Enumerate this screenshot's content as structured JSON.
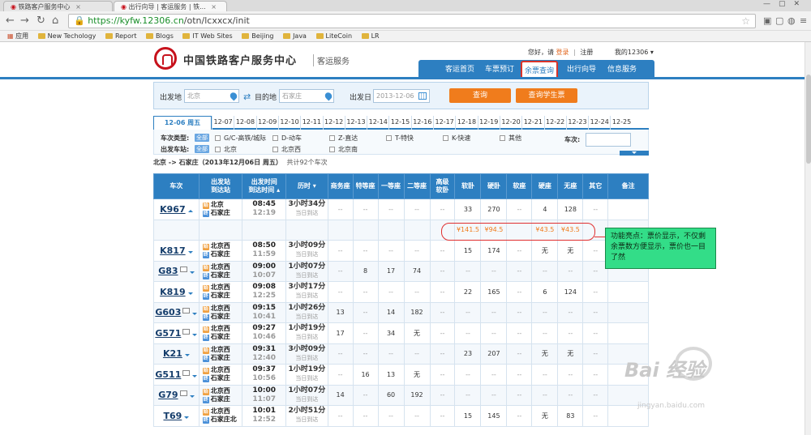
{
  "browser": {
    "tabs": [
      {
        "label": "铁路客户服务中心"
      },
      {
        "label": "出行向导 | 客运服务 | 铁..."
      }
    ],
    "url_host": "https://kyfw.12306.cn",
    "url_path": "/otn/lcxxcx/init",
    "bookmarks": [
      "应用",
      "New Techology",
      "Report",
      "Blogs",
      "IT Web Sites",
      "Beijing",
      "Java",
      "LiteCoin",
      "LR"
    ]
  },
  "site": {
    "name": "中国铁路客户服务中心",
    "sub": "客运服务",
    "greeting": "您好，请",
    "login": "登录",
    "register": "注册",
    "my": "我的12306"
  },
  "nav": {
    "items": [
      "客运首页",
      "车票预订",
      "余票查询",
      "出行向导",
      "信息服务"
    ],
    "active": "余票查询"
  },
  "search": {
    "from_label": "出发地",
    "from_value": "北京",
    "to_label": "目的地",
    "to_value": "石家庄",
    "date_label": "出发日",
    "date_value": "2013-12-06",
    "query_btn": "查询",
    "student_btn": "查询学生票"
  },
  "dates": [
    "12-06 周五",
    "12-07",
    "12-08",
    "12-09",
    "12-10",
    "12-11",
    "12-12",
    "12-13",
    "12-14",
    "12-15",
    "12-16",
    "12-17",
    "12-18",
    "12-19",
    "12-20",
    "12-21",
    "12-22",
    "12-23",
    "12-24",
    "12-25"
  ],
  "filters": {
    "type_label": "车次类型:",
    "station_label": "出发车站:",
    "all": "全部",
    "types": [
      "G/C-高铁/城际",
      "D-动车",
      "Z-直达",
      "T-特快",
      "K-快速",
      "其他"
    ],
    "stations": [
      "北京",
      "北京西",
      "北京南"
    ],
    "train_no_label": "车次:"
  },
  "summary": {
    "route": "北京 -> 石家庄（2013年12月06日 周五）",
    "count": "共计92个车次"
  },
  "table": {
    "headers": [
      "车次",
      "出发站\n到达站",
      "出发时间\n到达时间",
      "历时",
      "商务座",
      "特等座",
      "一等座",
      "二等座",
      "高级\n软卧",
      "软卧",
      "硬卧",
      "软座",
      "硬座",
      "无座",
      "其它",
      "备注"
    ],
    "rows": [
      {
        "no": "K967",
        "from": "北京",
        "to": "石家庄",
        "dep": "08:45",
        "arr": "12:19",
        "dur": "3小时34分",
        "arrday": "当日到达",
        "seats": [
          "--",
          "--",
          "--",
          "--",
          "--",
          "33",
          "270",
          "--",
          "4",
          "128",
          "--",
          ""
        ],
        "idcard": false,
        "arrow": "up"
      },
      {
        "price": true,
        "seats": [
          "",
          "",
          "",
          "",
          "",
          "¥141.5",
          "¥94.5",
          "",
          "¥43.5",
          "¥43.5",
          "",
          ""
        ]
      },
      {
        "no": "K817",
        "from": "北京西",
        "to": "石家庄",
        "dep": "08:50",
        "arr": "11:59",
        "dur": "3小时09分",
        "arrday": "当日到达",
        "seats": [
          "--",
          "--",
          "--",
          "--",
          "--",
          "15",
          "174",
          "--",
          "无",
          "无",
          "--",
          ""
        ],
        "idcard": false
      },
      {
        "no": "G83",
        "from": "北京西",
        "to": "石家庄",
        "dep": "09:00",
        "arr": "10:07",
        "dur": "1小时07分",
        "arrday": "当日到达",
        "seats": [
          "--",
          "8",
          "17",
          "74",
          "--",
          "--",
          "--",
          "--",
          "--",
          "--",
          "--",
          ""
        ],
        "idcard": true
      },
      {
        "no": "K819",
        "from": "北京西",
        "to": "石家庄",
        "dep": "09:08",
        "arr": "12:25",
        "dur": "3小时17分",
        "arrday": "当日到达",
        "seats": [
          "--",
          "--",
          "--",
          "--",
          "--",
          "22",
          "165",
          "--",
          "6",
          "124",
          "--",
          ""
        ],
        "idcard": false
      },
      {
        "no": "G603",
        "from": "北京西",
        "to": "石家庄",
        "dep": "09:15",
        "arr": "10:41",
        "dur": "1小时26分",
        "arrday": "当日到达",
        "seats": [
          "13",
          "--",
          "14",
          "182",
          "--",
          "--",
          "--",
          "--",
          "--",
          "--",
          "--",
          ""
        ],
        "idcard": true
      },
      {
        "no": "G571",
        "from": "北京西",
        "to": "石家庄",
        "dep": "09:27",
        "arr": "10:46",
        "dur": "1小时19分",
        "arrday": "当日到达",
        "seats": [
          "17",
          "--",
          "34",
          "无",
          "--",
          "--",
          "--",
          "--",
          "--",
          "--",
          "--",
          ""
        ],
        "idcard": true
      },
      {
        "no": "K21",
        "from": "北京西",
        "to": "石家庄",
        "dep": "09:31",
        "arr": "12:40",
        "dur": "3小时09分",
        "arrday": "当日到达",
        "seats": [
          "--",
          "--",
          "--",
          "--",
          "--",
          "23",
          "207",
          "--",
          "无",
          "无",
          "--",
          ""
        ],
        "idcard": false
      },
      {
        "no": "G511",
        "from": "北京西",
        "to": "石家庄",
        "dep": "09:37",
        "arr": "10:56",
        "dur": "1小时19分",
        "arrday": "当日到达",
        "seats": [
          "--",
          "16",
          "13",
          "无",
          "--",
          "--",
          "--",
          "--",
          "--",
          "--",
          "--",
          ""
        ],
        "idcard": true
      },
      {
        "no": "G79",
        "from": "北京西",
        "to": "石家庄",
        "dep": "10:00",
        "arr": "11:07",
        "dur": "1小时07分",
        "arrday": "当日到达",
        "seats": [
          "14",
          "--",
          "60",
          "192",
          "--",
          "--",
          "--",
          "--",
          "--",
          "--",
          "--",
          ""
        ],
        "idcard": true
      },
      {
        "no": "T69",
        "from": "北京西",
        "to": "石家庄北",
        "dep": "10:01",
        "arr": "12:52",
        "dur": "2小时51分",
        "arrday": "当日到达",
        "seats": [
          "--",
          "--",
          "--",
          "--",
          "--",
          "15",
          "145",
          "--",
          "无",
          "83",
          "--",
          ""
        ],
        "idcard": false
      }
    ]
  },
  "annotation": {
    "text": "功能亮点：票价显示，不仅剩余票数方便显示，票价也一目了然"
  },
  "watermark": {
    "main": "Bai 经验",
    "url": "jingyan.baidu.com"
  }
}
